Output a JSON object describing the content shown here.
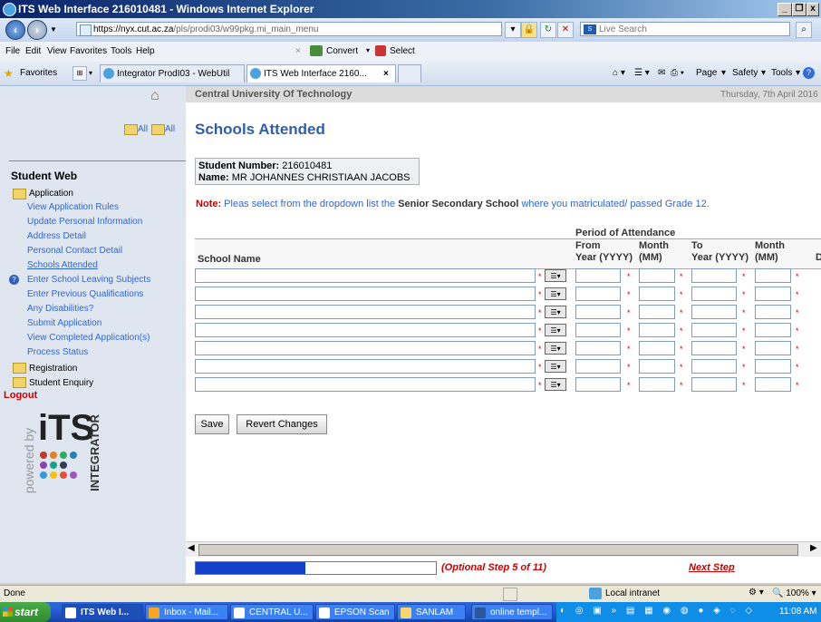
{
  "window": {
    "title": "ITS Web Interface 216010481 - Windows Internet Explorer"
  },
  "address_bar": {
    "host": "https://nyx.cut.ac.za",
    "path": "/pls/prodi03/w99pkg.mi_main_menu",
    "search_placeholder": "Live Search"
  },
  "menu": {
    "items": [
      "File",
      "Edit",
      "View",
      "Favorites",
      "Tools",
      "Help"
    ],
    "convert_label": "Convert",
    "select_label": "Select"
  },
  "favorites_bar": {
    "favorites_label": "Favorites",
    "tabs": [
      "Integrator ProdI03 - WebUtil",
      "ITS Web Interface 2160..."
    ],
    "commands": [
      "Page",
      "Safety",
      "Tools"
    ]
  },
  "sidebar": {
    "expand_all": "All",
    "collapse_all": "All",
    "section_title": "Student Web",
    "application_label": "Application",
    "links": [
      "View Application Rules",
      "Update Personal Information",
      "Address Detail",
      "Personal Contact Detail",
      "Schools Attended",
      "Enter School Leaving Subjects",
      "Enter Previous Qualifications",
      "Any Disabilities?",
      "Submit Application",
      "View Completed Application(s)",
      "Process Status"
    ],
    "registration_label": "Registration",
    "enquiry_label": "Student Enquiry",
    "logout_label": "Logout",
    "powered_by": "powered by",
    "logo_text": "iTS",
    "logo_sub": "INTEGRATOR"
  },
  "main": {
    "institution": "Central University Of Technology",
    "date": "Thursday, 7th April 2016",
    "page_title": "Schools Attended",
    "student_number_label": "Student Number:",
    "student_number": "216010481",
    "name_label": "Name:",
    "name": "MR JOHANNES CHRISTIAAN JACOBS",
    "note_label": "Note:",
    "note_text_1": " Pleas select from the dropdown list the ",
    "note_bold": "Senior Secondary School",
    "note_text_2": " where you matriculated/ passed Grade 12.",
    "period_header": "Period of Attendance",
    "col_school": "School Name",
    "col_from_1": "From",
    "col_from_2": "Year (YYYY)",
    "col_month1_1": "Month",
    "col_month1_2": "(MM)",
    "col_to_1": "To",
    "col_to_2": "Year (YYYY)",
    "col_month2_1": "Month",
    "col_month2_2": "(MM)",
    "col_trunc": "D",
    "save_label": "Save",
    "revert_label": "Revert Changes",
    "progress": {
      "fraction": 0.455,
      "label": "(Optional Step 5 of 11)"
    },
    "next_step": "Next Step"
  },
  "status_bar": {
    "text": "Done",
    "zone": "Local intranet",
    "zoom": "100%"
  },
  "taskbar": {
    "start": "start",
    "tasks": [
      "ITS Web I...",
      "Inbox - Mail...",
      "CENTRAL U...",
      "EPSON Scan",
      "SANLAM",
      "online templ..."
    ],
    "clock": "11:08 AM"
  }
}
